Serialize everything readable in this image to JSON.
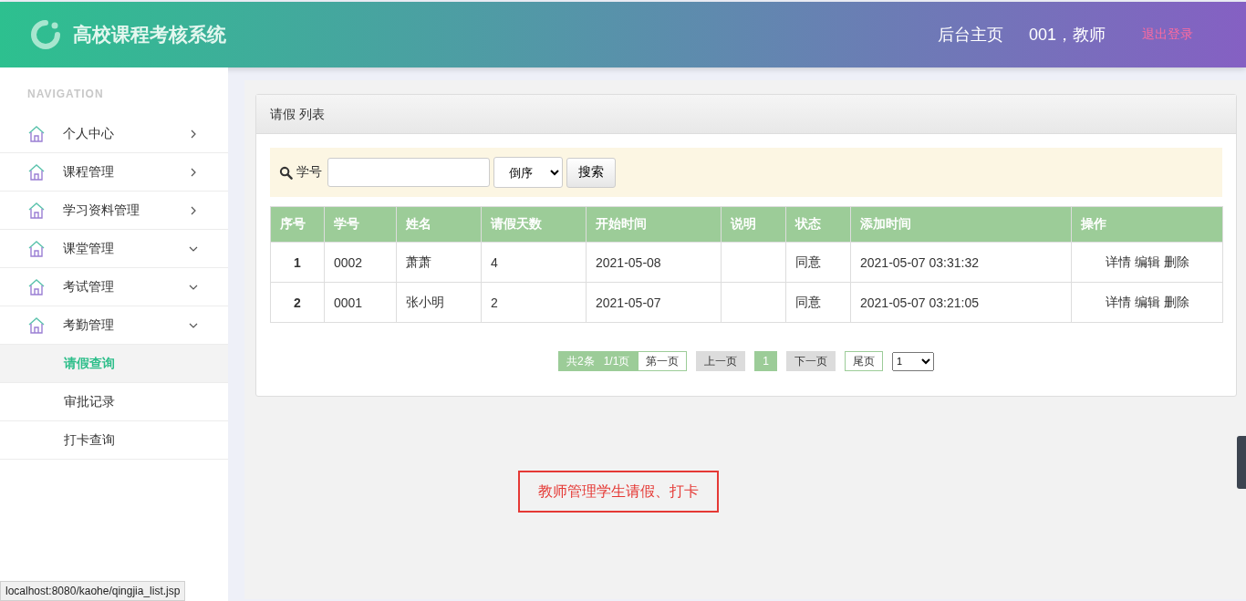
{
  "header": {
    "title": "高校课程考核系统",
    "links": [
      "后台主页",
      "001，教师"
    ],
    "logout": "退出登录"
  },
  "sidebar": {
    "heading": "NAVIGATION",
    "items": [
      {
        "label": "个人中心",
        "expanded": false
      },
      {
        "label": "课程管理",
        "expanded": false
      },
      {
        "label": "学习资料管理",
        "expanded": false
      },
      {
        "label": "课堂管理",
        "expanded": true
      },
      {
        "label": "考试管理",
        "expanded": true
      },
      {
        "label": "考勤管理",
        "expanded": true,
        "children": [
          {
            "label": "请假查询",
            "selected": true
          },
          {
            "label": "审批记录",
            "selected": false
          },
          {
            "label": "打卡查询",
            "selected": false
          }
        ]
      }
    ]
  },
  "panel": {
    "title": "请假 列表",
    "search": {
      "label": "学号",
      "order": "倒序",
      "button": "搜索"
    },
    "table": {
      "columns": [
        "序号",
        "学号",
        "姓名",
        "请假天数",
        "开始时间",
        "说明",
        "状态",
        "添加时间",
        "操作"
      ],
      "rows": [
        {
          "cells": [
            "1",
            "0002",
            "萧萧",
            "4",
            "2021-05-08",
            "",
            "同意",
            "2021-05-07 03:31:32"
          ],
          "actions": [
            "详情",
            "编辑",
            "删除"
          ]
        },
        {
          "cells": [
            "2",
            "0001",
            "张小明",
            "2",
            "2021-05-07",
            "",
            "同意",
            "2021-05-07 03:21:05"
          ],
          "actions": [
            "详情",
            "编辑",
            "删除"
          ]
        }
      ]
    },
    "pagination": {
      "total": "共2条",
      "pages": "1/1页",
      "items": [
        {
          "label": "第一页",
          "kind": "link",
          "selected": false
        },
        {
          "label": "上一页",
          "kind": "disabled",
          "selected": false
        },
        {
          "label": "1",
          "kind": "page",
          "selected": true
        },
        {
          "label": "下一页",
          "kind": "disabled",
          "selected": false
        },
        {
          "label": "尾页",
          "kind": "link",
          "selected": false
        }
      ],
      "jump": "1"
    }
  },
  "annotation": "教师管理学生请假、打卡",
  "status_bar": "localhost:8080/kaohe/qingjia_list.jsp"
}
